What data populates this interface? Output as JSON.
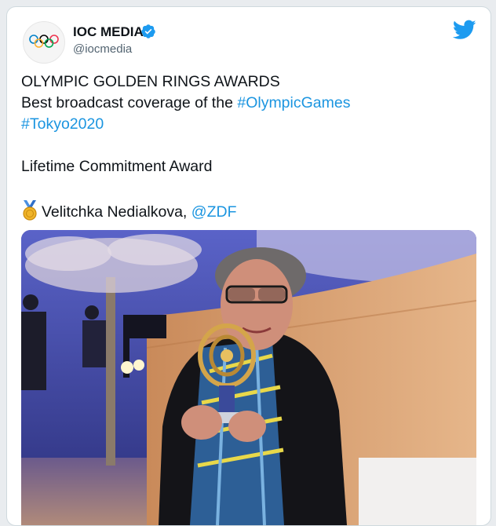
{
  "author": {
    "name": "IOC MEDIA",
    "handle": "@iocmedia",
    "verified": true,
    "avatar_icon": "olympic-rings-icon"
  },
  "platform_icon": "twitter-bird-icon",
  "tweet": {
    "line1": "OLYMPIC GOLDEN RINGS AWARDS",
    "line2_text": "Best broadcast coverage of the ",
    "line2_hashtag": "#OlympicGames",
    "line3_hashtag": "#Tokyo2020",
    "line4": "Lifetime Commitment Award",
    "line5_emoji": "medal-icon",
    "line5_text": "Velitchka Nedialkova, ",
    "line5_mention": "@ZDF"
  },
  "colors": {
    "link": "#1b95e0",
    "text": "#0f1419",
    "secondary": "#536471"
  }
}
